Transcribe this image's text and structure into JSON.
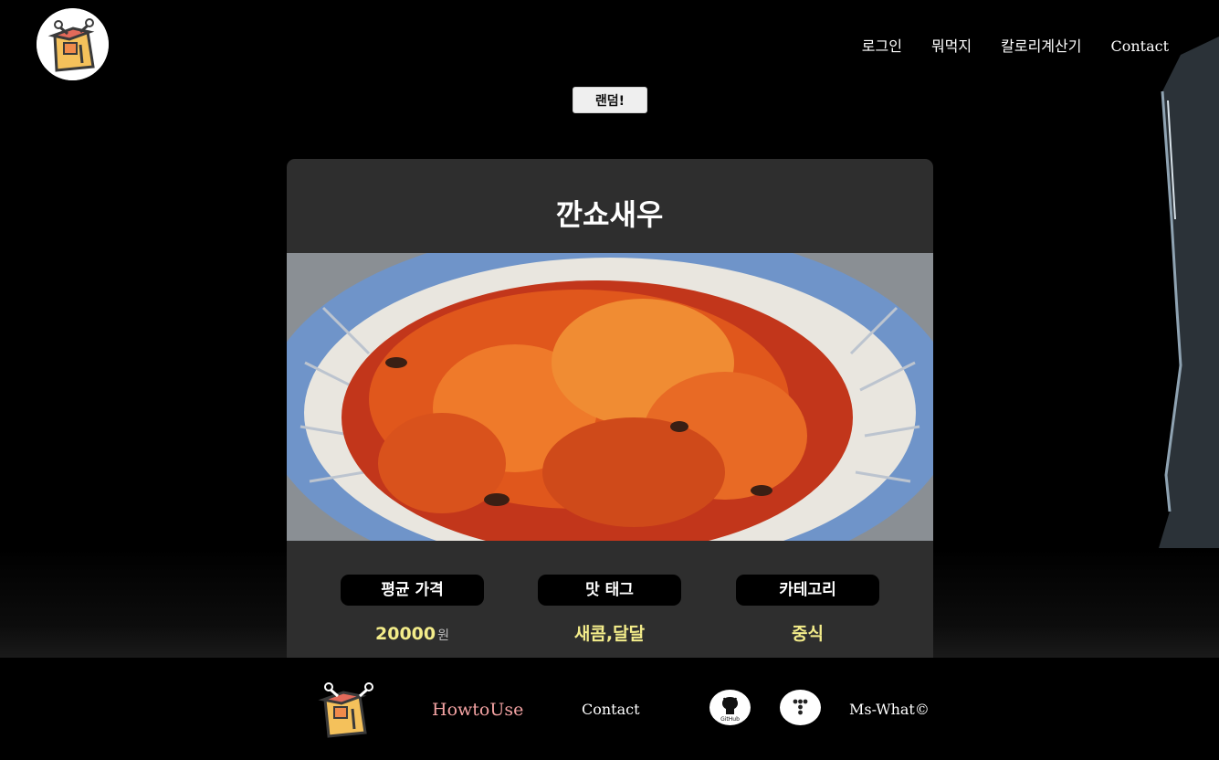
{
  "nav": {
    "login": "로그인",
    "whattoeat": "뭐먹지",
    "calorie": "칼로리계산기",
    "contact": "Contact"
  },
  "random_button": "랜덤!",
  "food": {
    "name": "깐쇼새우",
    "price_label": "평균 가격",
    "price_value": "20000",
    "price_unit": "원",
    "taste_label": "맛 태그",
    "taste_value": "새콤,달달",
    "category_label": "카테고리",
    "category_value": "중식"
  },
  "footer": {
    "howto": "HowtoUse",
    "contact": "Contact",
    "github_icon_text": "GitHub",
    "copyright": "Ms-What©"
  },
  "colors": {
    "page_bg": "#000000",
    "card_bg": "#2e2e2e",
    "value_yellow": "#f3ec8a",
    "howto_pink": "#f4a3a3"
  }
}
